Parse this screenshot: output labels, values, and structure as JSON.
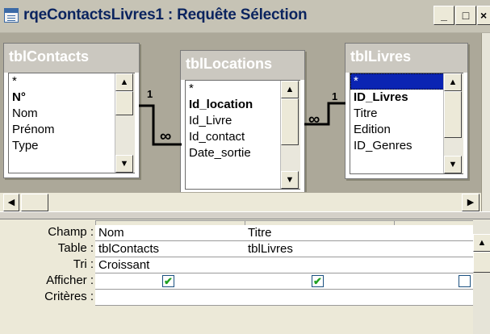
{
  "window": {
    "title": "rqeContactsLivres1 : Requête Sélection"
  },
  "titlebar_buttons": {
    "minimize": "_",
    "maximize": "□",
    "close": "×"
  },
  "tables": [
    {
      "name": "tblContacts",
      "fields": [
        {
          "label": "*"
        },
        {
          "label": "N°",
          "bold": true
        },
        {
          "label": "Nom"
        },
        {
          "label": "Prénom"
        },
        {
          "label": "Type"
        }
      ]
    },
    {
      "name": "tblLocations",
      "fields": [
        {
          "label": "*"
        },
        {
          "label": "Id_location",
          "bold": true
        },
        {
          "label": "Id_Livre"
        },
        {
          "label": "Id_contact"
        },
        {
          "label": "Date_sortie"
        }
      ]
    },
    {
      "name": "tblLivres",
      "fields": [
        {
          "label": "*",
          "selected": true
        },
        {
          "label": "ID_Livres",
          "bold": true
        },
        {
          "label": "Titre"
        },
        {
          "label": "Edition"
        },
        {
          "label": "ID_Genres"
        }
      ]
    }
  ],
  "joins": {
    "one": "1",
    "many": "∞"
  },
  "grid": {
    "row_labels": [
      "Champ :",
      "Table :",
      "Tri :",
      "Afficher :",
      "Critères :"
    ],
    "columns": [
      {
        "champ": "Nom",
        "table": "tblContacts",
        "tri": "Croissant",
        "afficher": true
      },
      {
        "champ": "Titre",
        "table": "tblLivres",
        "tri": "",
        "afficher": true
      },
      {
        "champ": "",
        "table": "",
        "tri": "",
        "afficher": false
      }
    ]
  },
  "icons": {
    "scroll_up": "arrow-up-icon",
    "scroll_down": "arrow-down-icon",
    "scroll_left": "arrow-left-icon",
    "scroll_right": "arrow-right-icon"
  },
  "colors": {
    "selection": "#0b24b3",
    "title_text": "#0b245f",
    "checkmark": "#21a121"
  }
}
